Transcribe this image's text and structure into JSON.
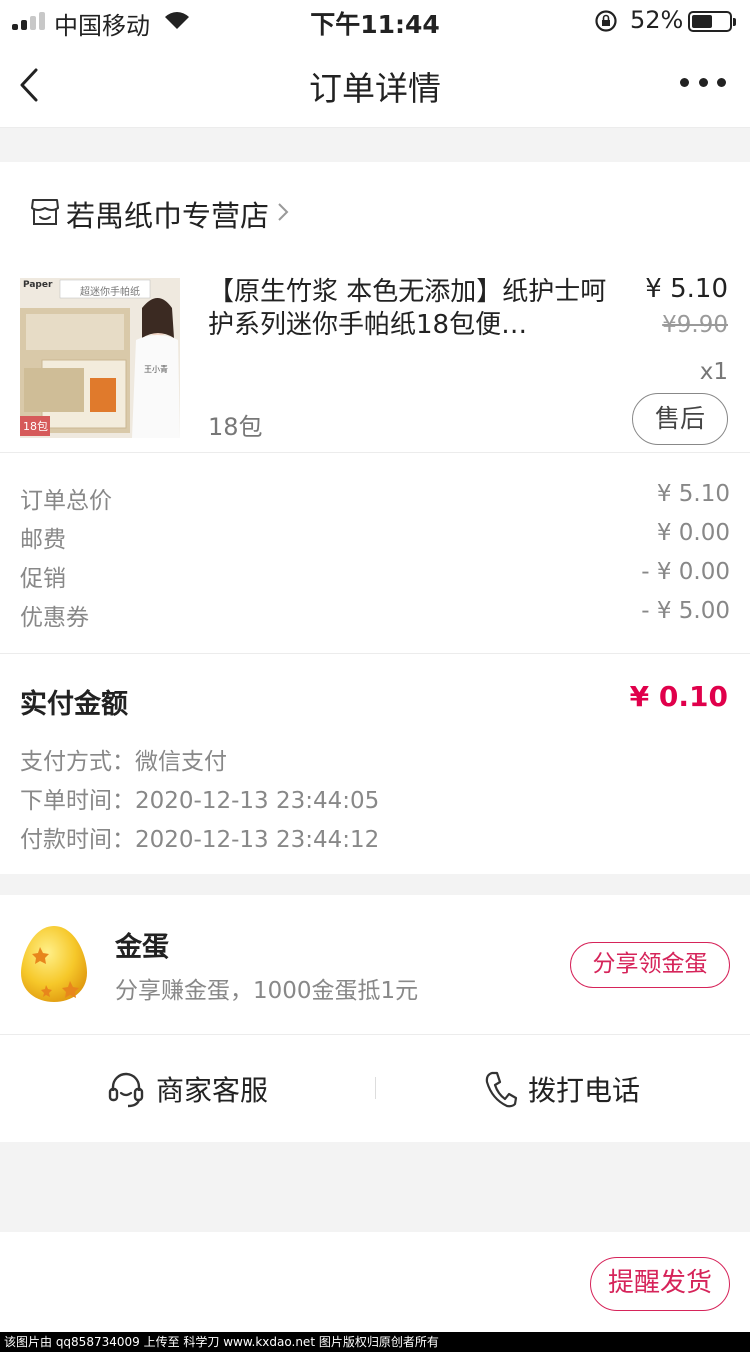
{
  "status_bar": {
    "carrier": "中国移动",
    "time": "下午11:44",
    "battery": "52%"
  },
  "nav": {
    "title": "订单详情"
  },
  "store": {
    "name": "若禺纸巾专营店"
  },
  "product": {
    "title": "【原生竹浆 本色无添加】纸护士呵护系列迷你手帕纸18包便…",
    "variant": "18包",
    "price": "¥ 5.10",
    "original_price": "¥9.90",
    "quantity": "x1",
    "after_sale_label": "售后",
    "image_texts": {
      "brand": "Paper",
      "banner": "超迷你手帕纸",
      "badge": "18包",
      "person": "王小青"
    }
  },
  "summary": [
    {
      "label": "订单总价",
      "value": "¥ 5.10"
    },
    {
      "label": "邮费",
      "value": "¥ 0.00"
    },
    {
      "label": "促销",
      "value": "- ¥ 0.00"
    },
    {
      "label": "优惠券",
      "value": "- ¥ 5.00"
    }
  ],
  "payment": {
    "paid_label": "实付金额",
    "paid_value": "¥ 0.10",
    "method": "支付方式：微信支付",
    "order_time": "下单时间：2020-12-13 23:44:05",
    "pay_time": "付款时间：2020-12-13 23:44:12"
  },
  "egg": {
    "title": "金蛋",
    "desc": "分享赚金蛋，1000金蛋抵1元",
    "button": "分享领金蛋"
  },
  "contact": {
    "service": "商家客服",
    "phone": "拨打电话"
  },
  "bottom": {
    "remind": "提醒发货"
  },
  "watermark": "该图片由 qq858734009 上传至 科学刀 www.kxdao.net 图片版权归原创者所有",
  "colors": {
    "accent": "#e0004b",
    "button_border": "#d6245a"
  }
}
